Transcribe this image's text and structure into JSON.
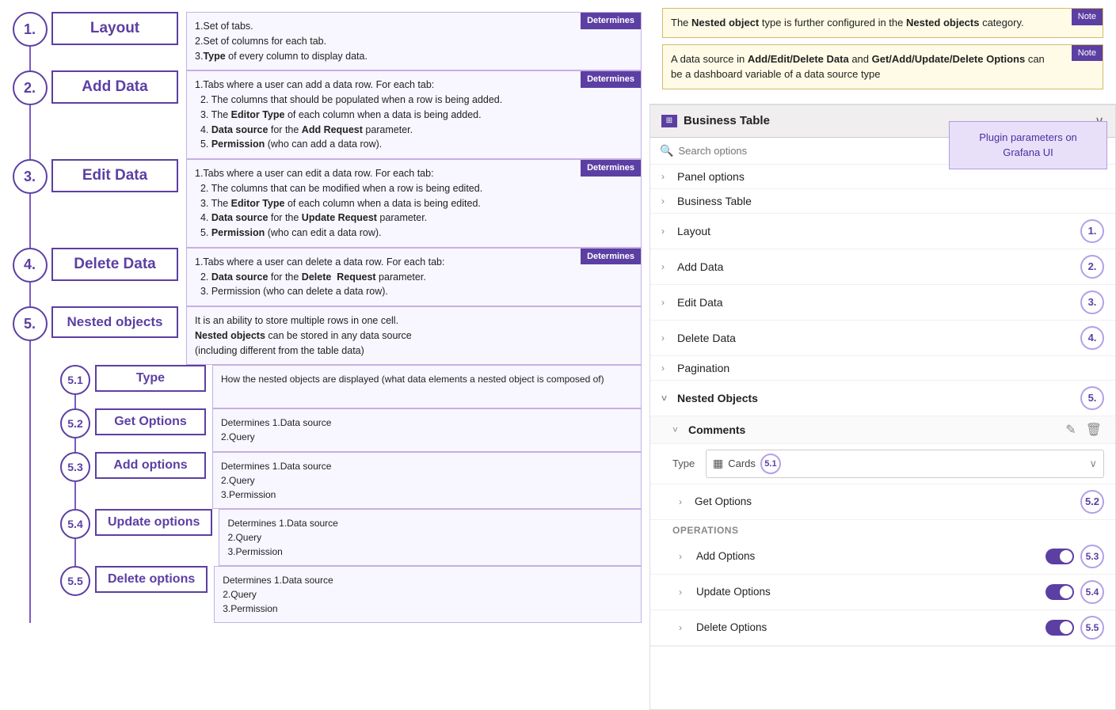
{
  "left": {
    "steps": [
      {
        "number": "1.",
        "label": "Layout",
        "desc": "1.Set of tabs.\n2.Set of columns for each tab.\n3.Type of every column to display data.",
        "determines": true
      },
      {
        "number": "2.",
        "label": "Add Data",
        "desc": "1.Tabs where a user can add a data row. For each tab:\n  2. The columns that should be populated when a row is being added.\n  3. The Editor Type of each column when a data is being added.\n  4. Data source for the Add Request parameter.\n  5. Permission (who can add a data row).",
        "determines": true
      },
      {
        "number": "3.",
        "label": "Edit Data",
        "desc": "1.Tabs where a user can edit a data row. For each tab:\n  2. The columns that can be modified when a row is being edited.\n  3. The Editor Type of each column when a data is being edited.\n  4. Data source for the Update Request parameter.\n  5. Permission (who can edit a data row).",
        "determines": true
      },
      {
        "number": "4.",
        "label": "Delete Data",
        "desc": "1.Tabs where a user can delete a data row. For each tab:\n  2. Data source for the Delete  Request parameter.\n  3. Permission (who can delete a data row).",
        "determines": true
      },
      {
        "number": "5.",
        "label": "Nested objects",
        "desc": "It is an ability to store multiple rows in one cell.\nNested objects can be stored in any data source\n(including different from the table data)",
        "determines": false
      }
    ],
    "sub_steps": [
      {
        "number": "5.1",
        "label": "Type",
        "desc": "How the nested objects are displayed (what data elements a nested object is composed of)",
        "determines": false
      },
      {
        "number": "5.2",
        "label": "Get Options",
        "desc": "1.Data source\n2.Query",
        "determines": true
      },
      {
        "number": "5.3",
        "label": "Add options",
        "desc": "1.Data source\n2.Query\n3.Permission",
        "determines": true
      },
      {
        "number": "5.4",
        "label": "Update options",
        "desc": "1.Data source\n2.Query\n3.Permission",
        "determines": true
      },
      {
        "number": "5.5",
        "label": "Delete options",
        "desc": "1.Data source\n2.Query\n3.Permission",
        "determines": true
      }
    ],
    "determines_label": "Determines"
  },
  "right": {
    "notes": [
      {
        "text": "The Nested object type is further configured in the Nested objects category.",
        "bold_parts": [
          "Nested object",
          "Nested objects"
        ],
        "tag": "Note"
      },
      {
        "text": "A data source in Add/Edit/Delete Data and Get/Add/Update/Delete Options can be a dashboard variable of a data source type",
        "bold_parts": [
          "Add/Edit/Delete Data",
          "Get/Add/Update/Delete Options"
        ],
        "tag": "Note"
      }
    ],
    "plugin_hint": "Plugin parameters\non Grafana UI",
    "panel": {
      "title": "Business Table",
      "search_placeholder": "Search options",
      "tree_items": [
        {
          "label": "Panel options",
          "badge": null,
          "chevron": "›",
          "indent": 0
        },
        {
          "label": "Business Table",
          "badge": null,
          "chevron": "›",
          "indent": 0
        },
        {
          "label": "Layout",
          "badge": "1.",
          "chevron": "›",
          "indent": 0
        },
        {
          "label": "Add Data",
          "badge": "2.",
          "chevron": "›",
          "indent": 0
        },
        {
          "label": "Edit Data",
          "badge": "3.",
          "chevron": "›",
          "indent": 0
        },
        {
          "label": "Delete Data",
          "badge": "4.",
          "chevron": "›",
          "indent": 0
        },
        {
          "label": "Pagination",
          "badge": null,
          "chevron": "›",
          "indent": 0
        },
        {
          "label": "Nested Objects",
          "badge": "5.",
          "chevron": "˅",
          "indent": 0
        }
      ],
      "nested_objects": {
        "label": "Nested Objects",
        "badge": "5.",
        "comments_label": "Comments",
        "type_label": "Type",
        "type_icon": "▦",
        "type_value": "Cards",
        "type_badge": "5.1",
        "get_options_label": "Get Options",
        "get_options_badge": "5.2",
        "operations_label": "Operations",
        "operations": [
          {
            "label": "Add Options",
            "badge": "5.3",
            "enabled": true
          },
          {
            "label": "Update Options",
            "badge": "5.4",
            "enabled": true
          },
          {
            "label": "Delete Options",
            "badge": "5.5",
            "enabled": true
          }
        ]
      }
    }
  }
}
